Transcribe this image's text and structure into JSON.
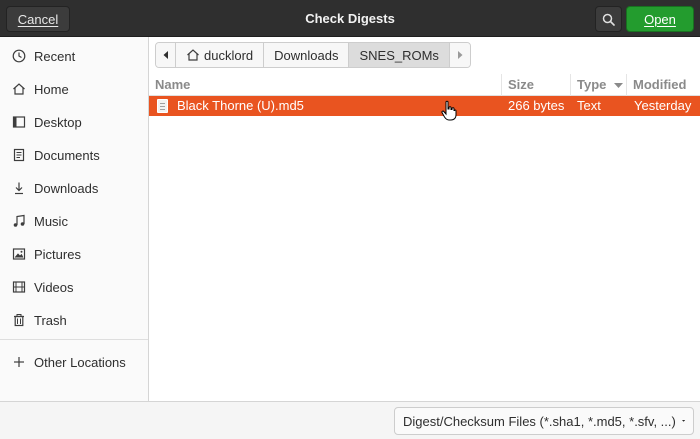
{
  "header": {
    "title": "Check Digests",
    "cancel_label": "Cancel",
    "open_label": "Open",
    "open_color": "#239c2e"
  },
  "sidebar": {
    "items": [
      {
        "label": "Recent",
        "icon": "clock-icon"
      },
      {
        "label": "Home",
        "icon": "home-icon"
      },
      {
        "label": "Desktop",
        "icon": "desktop-icon"
      },
      {
        "label": "Documents",
        "icon": "documents-icon"
      },
      {
        "label": "Downloads",
        "icon": "download-icon"
      },
      {
        "label": "Music",
        "icon": "music-icon"
      },
      {
        "label": "Pictures",
        "icon": "pictures-icon"
      },
      {
        "label": "Videos",
        "icon": "videos-icon"
      },
      {
        "label": "Trash",
        "icon": "trash-icon"
      },
      {
        "label": "Other Locations",
        "icon": "plus-icon"
      }
    ]
  },
  "pathbar": {
    "segments": [
      "ducklord",
      "Downloads",
      "SNES_ROMs"
    ],
    "active_index": 2
  },
  "filelist": {
    "columns": [
      "Name",
      "Size",
      "Type",
      "Modified"
    ],
    "rows": [
      {
        "name": "Black Thorne (U).md5",
        "size": "266 bytes",
        "type": "Text",
        "modified": "Yesterday",
        "selected": true
      }
    ],
    "selection_color": "#e95420"
  },
  "filter": {
    "selected": "Digest/Checksum Files (*.sha1, *.md5, *.sfv, ...)"
  }
}
